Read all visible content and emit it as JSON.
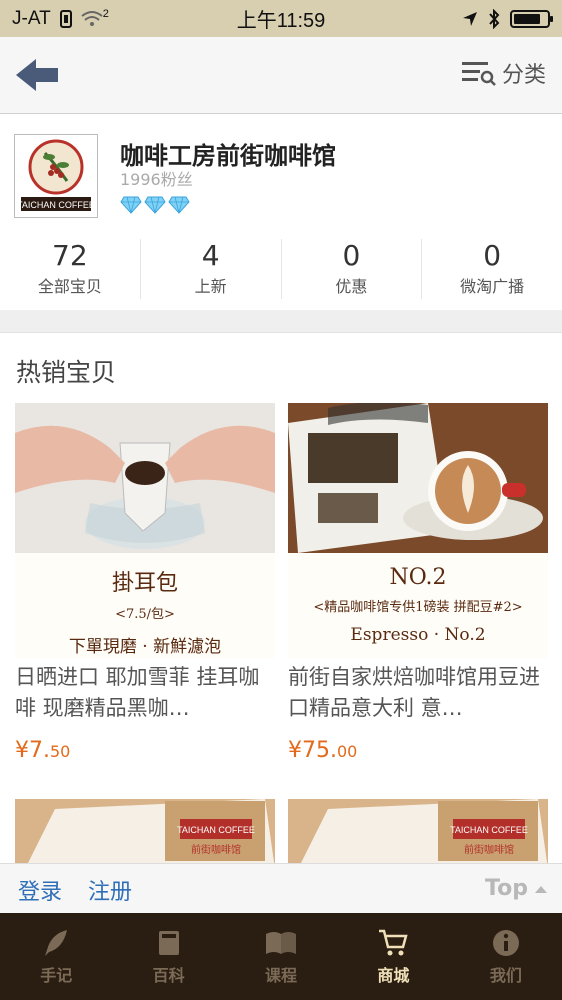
{
  "status": {
    "carrier": "J-AT",
    "signal_badge": "2",
    "time": "上午11:59"
  },
  "nav": {
    "category_label": "分类"
  },
  "store": {
    "name": "咖啡工房前街咖啡馆",
    "fans": "1996粉丝",
    "logo_text": "TAICHAN COFFEE",
    "stats": [
      {
        "value": "72",
        "label": "全部宝贝"
      },
      {
        "value": "4",
        "label": "上新"
      },
      {
        "value": "0",
        "label": "优惠"
      },
      {
        "value": "0",
        "label": "微淘广播"
      }
    ]
  },
  "hot": {
    "title": "热销宝贝",
    "items": [
      {
        "promo_line1": "掛耳包",
        "promo_line2": "<7.5/包>",
        "promo_line3": "下單現磨 · 新鮮濾泡",
        "name": "日晒进口 耶加雪菲 挂耳咖啡 现磨精品黑咖…",
        "price_main": "¥7.",
        "price_cents": "50"
      },
      {
        "promo_line1": "NO.2",
        "promo_line2": "<精品咖啡馆专供1磅装 拼配豆#2>",
        "promo_line3": "Espresso · No.2",
        "name": "前街自家烘焙咖啡馆用豆进口精品意大利 意…",
        "price_main": "¥75.",
        "price_cents": "00"
      }
    ],
    "thumb_label": "TAICHAN COFFEE",
    "thumb_sub": "前街咖啡馆"
  },
  "login": {
    "login_label": "登录",
    "register_label": "注册",
    "top_label": "Top"
  },
  "tabs": [
    {
      "label": "手记",
      "icon": "quill-icon",
      "active": false
    },
    {
      "label": "百科",
      "icon": "book-icon",
      "active": false
    },
    {
      "label": "课程",
      "icon": "open-book-icon",
      "active": false
    },
    {
      "label": "商城",
      "icon": "cart-icon",
      "active": true
    },
    {
      "label": "我们",
      "icon": "info-icon",
      "active": false
    }
  ],
  "colors": {
    "status_bg": "#d8cfb0",
    "tab_bg": "#2a1d12",
    "price": "#e36a1b",
    "link": "#2f6fb7"
  }
}
